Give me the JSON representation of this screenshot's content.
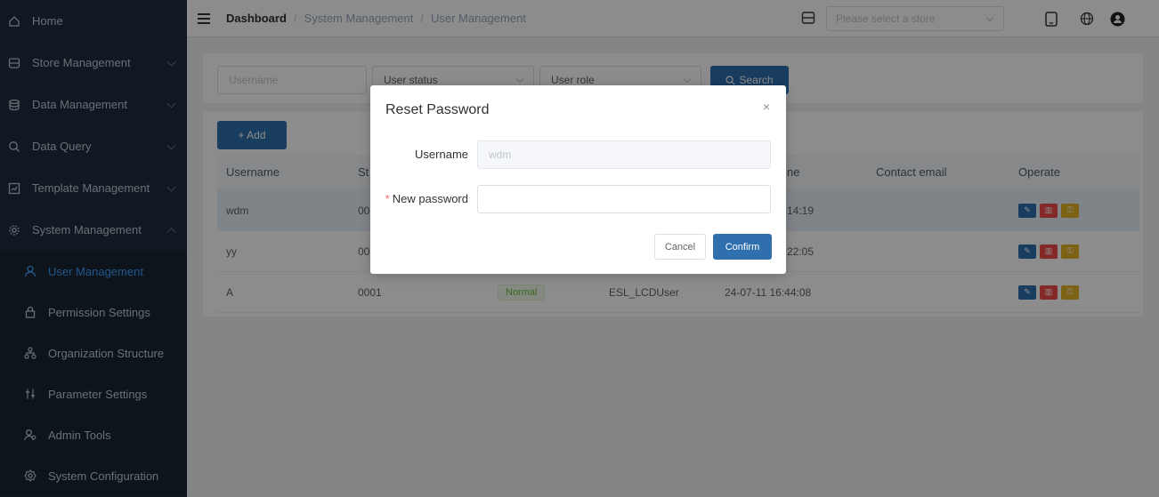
{
  "sidebar": {
    "items": [
      {
        "label": "Home",
        "icon": "home-icon",
        "chevron": "none"
      },
      {
        "label": "Store Management",
        "icon": "store-icon",
        "chevron": "down"
      },
      {
        "label": "Data Management",
        "icon": "database-icon",
        "chevron": "down"
      },
      {
        "label": "Data Query",
        "icon": "search-icon",
        "chevron": "down"
      },
      {
        "label": "Template Management",
        "icon": "template-icon",
        "chevron": "down"
      },
      {
        "label": "System Management",
        "icon": "gear-icon",
        "chevron": "up"
      }
    ],
    "subitems": [
      {
        "label": "User Management",
        "icon": "user-icon",
        "active": true
      },
      {
        "label": "Permission Settings",
        "icon": "lock-icon",
        "active": false
      },
      {
        "label": "Organization Structure",
        "icon": "org-chart-icon",
        "active": false
      },
      {
        "label": "Parameter Settings",
        "icon": "sliders-icon",
        "active": false
      },
      {
        "label": "Admin Tools",
        "icon": "admin-icon",
        "active": false
      },
      {
        "label": "System Configuration",
        "icon": "config-icon",
        "active": false
      }
    ]
  },
  "header": {
    "breadcrumb": [
      "Dashboard",
      "System Management",
      "User Management"
    ],
    "store_placeholder": "Please select a store"
  },
  "filters": {
    "username_placeholder": "Username",
    "status_placeholder": "User status",
    "role_placeholder": "User role",
    "search_label": "Search"
  },
  "table": {
    "add_label": "+ Add",
    "columns": [
      "Username",
      "St",
      "",
      "",
      "ne",
      "Contact email",
      "Operate"
    ],
    "rows": [
      {
        "username": "wdm",
        "store": "00",
        "status": "",
        "role": "",
        "time": "14:19",
        "email": "",
        "highlight": true
      },
      {
        "username": "yy",
        "store": "00",
        "status": "",
        "role": "",
        "time": "22:05",
        "email": "",
        "highlight": false
      },
      {
        "username": "A",
        "store": "0001",
        "status": "Normal",
        "role": "ESL_LCDUser",
        "time": "24-07-11 16:44:08",
        "email": "",
        "highlight": false
      }
    ]
  },
  "dialog": {
    "title": "Reset Password",
    "close": "×",
    "username_label": "Username",
    "username_value": "wdm",
    "password_required": "*",
    "password_label": "New password",
    "password_value": "",
    "cancel_label": "Cancel",
    "confirm_label": "Confirm"
  },
  "colors": {
    "sidebar_bg": "#1f2d3d",
    "primary": "#2f6fad",
    "active_menu": "#409eff",
    "danger": "#f04a4a",
    "warning": "#e6b325"
  }
}
